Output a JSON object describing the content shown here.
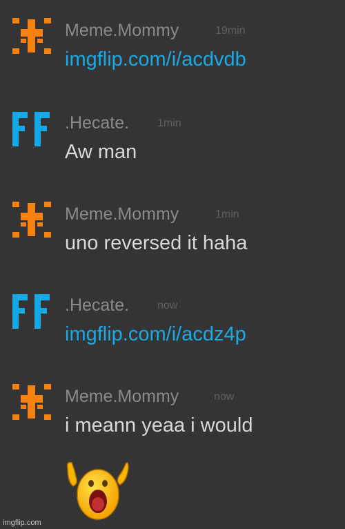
{
  "colors": {
    "background": "#343434",
    "username": "#8a8a8a",
    "timestamp": "#5f5f5f",
    "message_text": "#d8d8d8",
    "link": "#18a9e6",
    "avatar_orange": "#f7820f",
    "avatar_blue": "#13a8e8"
  },
  "messages": [
    {
      "user": "Meme.Mommy",
      "time": "19min",
      "text": "imgflip.com/i/acdvdb",
      "avatar_icon": "orange-cross-avatar-icon"
    },
    {
      "user": ".Hecate.",
      "time": "1min",
      "text": "Aw man",
      "avatar_icon": "blue-ff-avatar-icon"
    },
    {
      "user": "Meme.Mommy",
      "time": "1min",
      "text": "uno reversed it haha",
      "avatar_icon": "orange-cross-avatar-icon"
    },
    {
      "user": ".Hecate.",
      "time": "now",
      "text": "imgflip.com/i/acdz4p",
      "avatar_icon": "blue-ff-avatar-icon"
    },
    {
      "user": "Meme.Mommy",
      "time": "now",
      "text": "i meann yeaa i would",
      "avatar_icon": "orange-cross-avatar-icon"
    }
  ],
  "emoji_icon": "screaming-face-icon",
  "watermark": "imgflip.com"
}
